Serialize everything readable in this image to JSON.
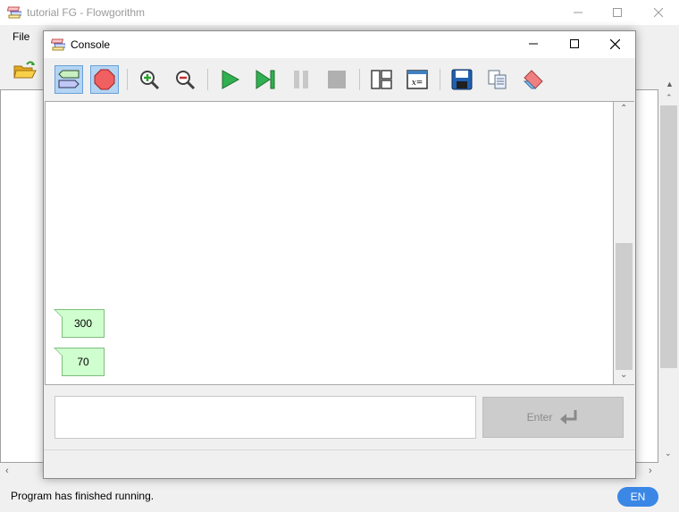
{
  "main": {
    "title": "tutorial FG - Flowgorithm",
    "menu": {
      "file": "File"
    },
    "status": "Program has finished running.",
    "language": "EN"
  },
  "console": {
    "title": "Console",
    "toolbar": [
      {
        "name": "output-bubble-mode-button",
        "icon": "speech-bubble-icon",
        "active": true
      },
      {
        "name": "stop-sign-button",
        "icon": "stop-sign-icon",
        "active": true
      },
      {
        "name": "zoom-in-button",
        "icon": "zoom-in-icon",
        "active": false
      },
      {
        "name": "zoom-out-button",
        "icon": "zoom-out-icon",
        "active": false
      },
      {
        "name": "run-button",
        "icon": "play-icon",
        "active": false
      },
      {
        "name": "step-button",
        "icon": "step-icon",
        "active": false
      },
      {
        "name": "pause-button",
        "icon": "pause-icon",
        "active": false
      },
      {
        "name": "stop-button",
        "icon": "stop-icon",
        "active": false
      },
      {
        "name": "layout-button",
        "icon": "layout-icon",
        "active": false
      },
      {
        "name": "variables-button",
        "icon": "variables-icon",
        "active": false
      },
      {
        "name": "save-button",
        "icon": "save-icon",
        "active": false
      },
      {
        "name": "copy-button",
        "icon": "copy-icon",
        "active": false
      },
      {
        "name": "clear-button",
        "icon": "eraser-icon",
        "active": false
      }
    ],
    "variables_icon_text": "x=",
    "outputs": [
      "300",
      "70"
    ],
    "input": {
      "value": "",
      "placeholder": ""
    },
    "enter_label": "Enter"
  },
  "colors": {
    "accent": "#3a87e6",
    "output_bubble": "#cfffcf",
    "active_tool": "#b4d4f4"
  }
}
